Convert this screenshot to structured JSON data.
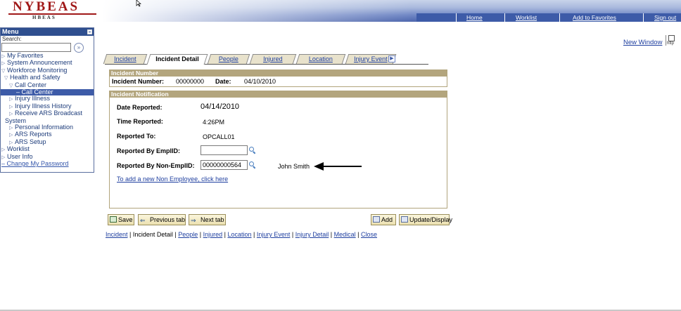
{
  "logo": {
    "main": "NYBEAS",
    "sub": "HBEAS"
  },
  "nav": {
    "home": "Home",
    "worklist": "Worklist",
    "add_favorites": "Add to Favorites",
    "sign_out": "Sign out"
  },
  "right": {
    "new_window": "New Window",
    "help": "http"
  },
  "menu": {
    "title": "Menu",
    "search_label": "Search:",
    "search_btn": "»",
    "items": [
      {
        "label": "My Favorites"
      },
      {
        "label": "System Announcement"
      },
      {
        "label": "Workforce Monitoring"
      },
      {
        "label": "Health and Safety"
      },
      {
        "label": "Call Center"
      },
      {
        "label": "Call Center"
      },
      {
        "label": "Injury Illness"
      },
      {
        "label": "Injury Illness History"
      },
      {
        "label": "Receive ARS Broadcast"
      },
      {
        "label": "System"
      },
      {
        "label": "Personal Information"
      },
      {
        "label": "ARS Reports"
      },
      {
        "label": "ARS Setup"
      },
      {
        "label": "Worklist"
      },
      {
        "label": "User Info"
      },
      {
        "label": "Change My Password"
      }
    ]
  },
  "tabs": [
    "Incident",
    "Incident Detail",
    "People",
    "Injured",
    "Location",
    "Injury Event"
  ],
  "incident_number_box": {
    "header": "Incident Number",
    "number_label": "Incident Number:",
    "number_value": "00000000",
    "date_label": "Date:",
    "date_value": "04/10/2010"
  },
  "notification": {
    "header": "Incident Notification",
    "date_reported_label": "Date Reported:",
    "date_reported_value": "04/14/2010",
    "time_reported_label": "Time Reported:",
    "time_reported_value": "4:26PM",
    "reported_to_label": "Reported To:",
    "reported_to_value": "OPCALL01",
    "by_emplid_label": "Reported By EmplID:",
    "by_emplid_value": "",
    "by_nonemplid_label": "Reported By Non-EmplID:",
    "by_nonemplid_value": "00000000564",
    "person_name": "John Smith",
    "add_nonemp_link": "To add a new Non Employee, click here"
  },
  "buttons": {
    "save": "Save",
    "prev_tab": "Previous tab",
    "next_tab": "Next tab",
    "add": "Add",
    "update": "Update/Display"
  },
  "bottom_links": [
    "Incident",
    "Incident Detail",
    "People",
    "Injured",
    "Location",
    "Injury Event",
    "Injury Detail",
    "Medical",
    "Close"
  ],
  "colors": {
    "brand_red": "#a01818",
    "header_blue": "#3d5ba8",
    "groupbox_tan": "#b3a57d"
  }
}
